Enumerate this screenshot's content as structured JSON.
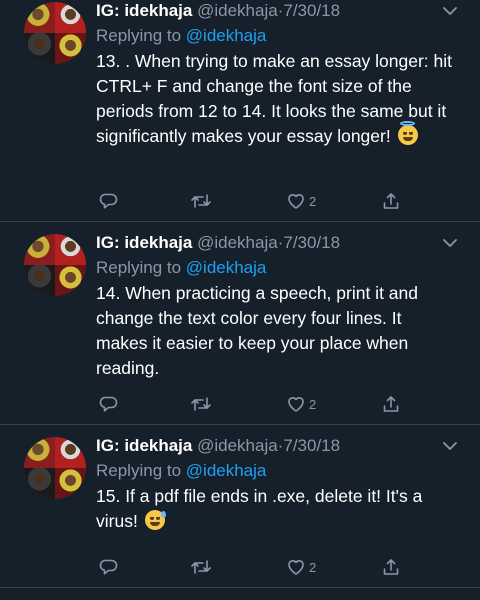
{
  "tweets": [
    {
      "name": "IG: idekhaja",
      "handle": "@idekhaja",
      "dot": "·",
      "date": "7/30/18",
      "replying_prefix": "Replying to ",
      "replying_to": "@idekhaja",
      "text": "13. . When trying to make an essay longer: hit CTRL+ F and change the font size of the periods from 12 to 14. It looks the same but it significantly makes your essay longer!",
      "emoji": "smiling-face-with-halo",
      "likes": "2"
    },
    {
      "name": "IG: idekhaja",
      "handle": "@idekhaja",
      "dot": "·",
      "date": "7/30/18",
      "replying_prefix": "Replying to ",
      "replying_to": "@idekhaja",
      "text": "14. When practicing a speech, print it and change the text color every four lines. It makes it easier to keep your place when reading.",
      "emoji": "",
      "likes": "2"
    },
    {
      "name": "IG: idekhaja",
      "handle": "@idekhaja",
      "dot": "·",
      "date": "7/30/18",
      "replying_prefix": "Replying to ",
      "replying_to": "@idekhaja",
      "text": "15. If a pdf file ends in .exe, delete it! It's a virus!",
      "emoji": "grinning-face-with-sweat",
      "likes": "2"
    }
  ],
  "colors": {
    "background": "#15202b",
    "secondary_text": "#8899a6",
    "link": "#1da1f2",
    "divider": "#38444d"
  },
  "icons": [
    "reply-icon",
    "retweet-icon",
    "like-icon",
    "share-icon",
    "chevron-down-icon"
  ]
}
